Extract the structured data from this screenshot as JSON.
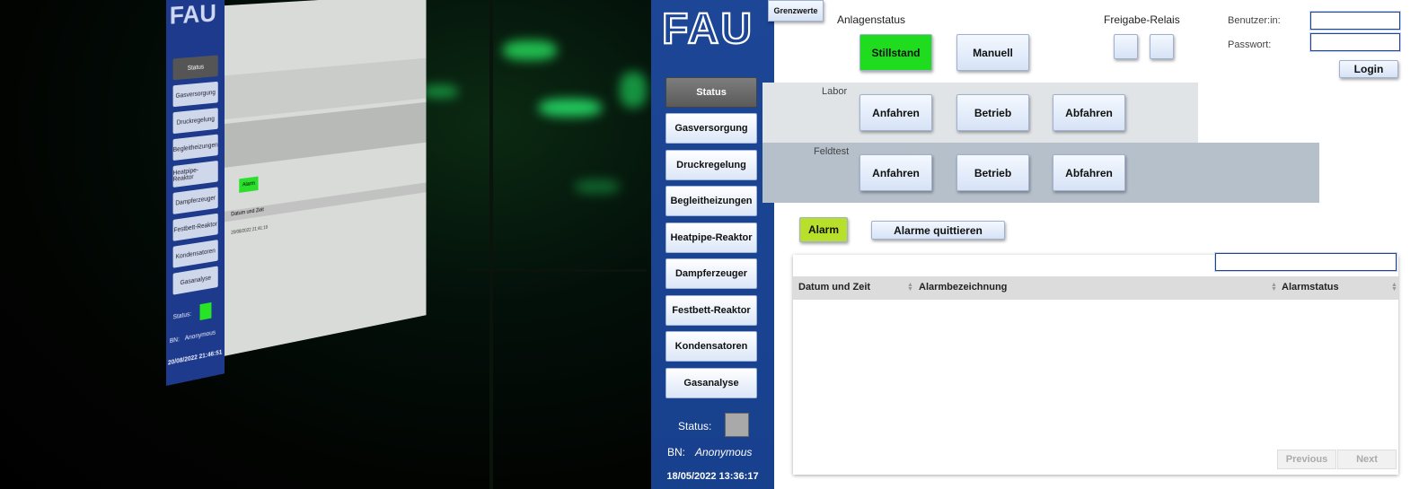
{
  "photo": {
    "logo": "FAU",
    "nav": [
      "Status",
      "Gasversorgung",
      "Druckregelung",
      "Begleitheizungen",
      "Heatpipe-Reaktor",
      "Dampferzeuger",
      "Festbett-Reaktor",
      "Kondensatoren",
      "Gasanalyse"
    ],
    "status_label": "Status:",
    "bn_label": "BN:",
    "bn_value": "Anonymous",
    "datetime": "20/08/2022 21:46:51",
    "alarm_label": "Alarm",
    "col_datetime": "Datum und Zeit",
    "row_time": "20/08/2022 21:41:19"
  },
  "sidebar": {
    "logo": "FAU",
    "items": [
      {
        "label": "Status",
        "active": true
      },
      {
        "label": "Gasversorgung"
      },
      {
        "label": "Druckregelung"
      },
      {
        "label": "Begleitheizungen"
      },
      {
        "label": "Heatpipe-Reaktor"
      },
      {
        "label": "Dampferzeuger"
      },
      {
        "label": "Festbett-Reaktor"
      },
      {
        "label": "Kondensatoren"
      },
      {
        "label": "Gasanalyse"
      }
    ],
    "status_label": "Status:",
    "status_color": "#a9a9a9",
    "bn_label": "BN:",
    "bn_value": "Anonymous",
    "datetime": "18/05/2022 13:36:17"
  },
  "header": {
    "grenzwerte_tab": "Grenzwerte",
    "anlagenstatus_label": "Anlagenstatus",
    "stillstand_button": "Stillstand",
    "stillstand_color": "#1fdc1f",
    "manuell_button": "Manuell",
    "freigabe_label": "Freigabe-Relais"
  },
  "login": {
    "user_label": "Benutzer:in:",
    "password_label": "Passwort:",
    "user_value": "",
    "password_value": "",
    "login_button": "Login"
  },
  "labor": {
    "label": "Labor",
    "band_color": "#e1e4e7",
    "buttons": [
      "Anfahren",
      "Betrieb",
      "Abfahren"
    ]
  },
  "feldtest": {
    "label": "Feldtest",
    "band_color": "#b6c0cb",
    "buttons": [
      "Anfahren",
      "Betrieb",
      "Abfahren"
    ]
  },
  "alarm": {
    "alarm_button": "Alarm",
    "alarm_color": "#b8e02a",
    "quit_button": "Alarme quittieren"
  },
  "table": {
    "search_value": "",
    "columns": [
      "Datum und Zeit",
      "Alarmbezeichnung",
      "Alarmstatus"
    ],
    "rows": [],
    "previous_button": "Previous",
    "next_button": "Next"
  },
  "icons": [
    "sort-icon"
  ]
}
